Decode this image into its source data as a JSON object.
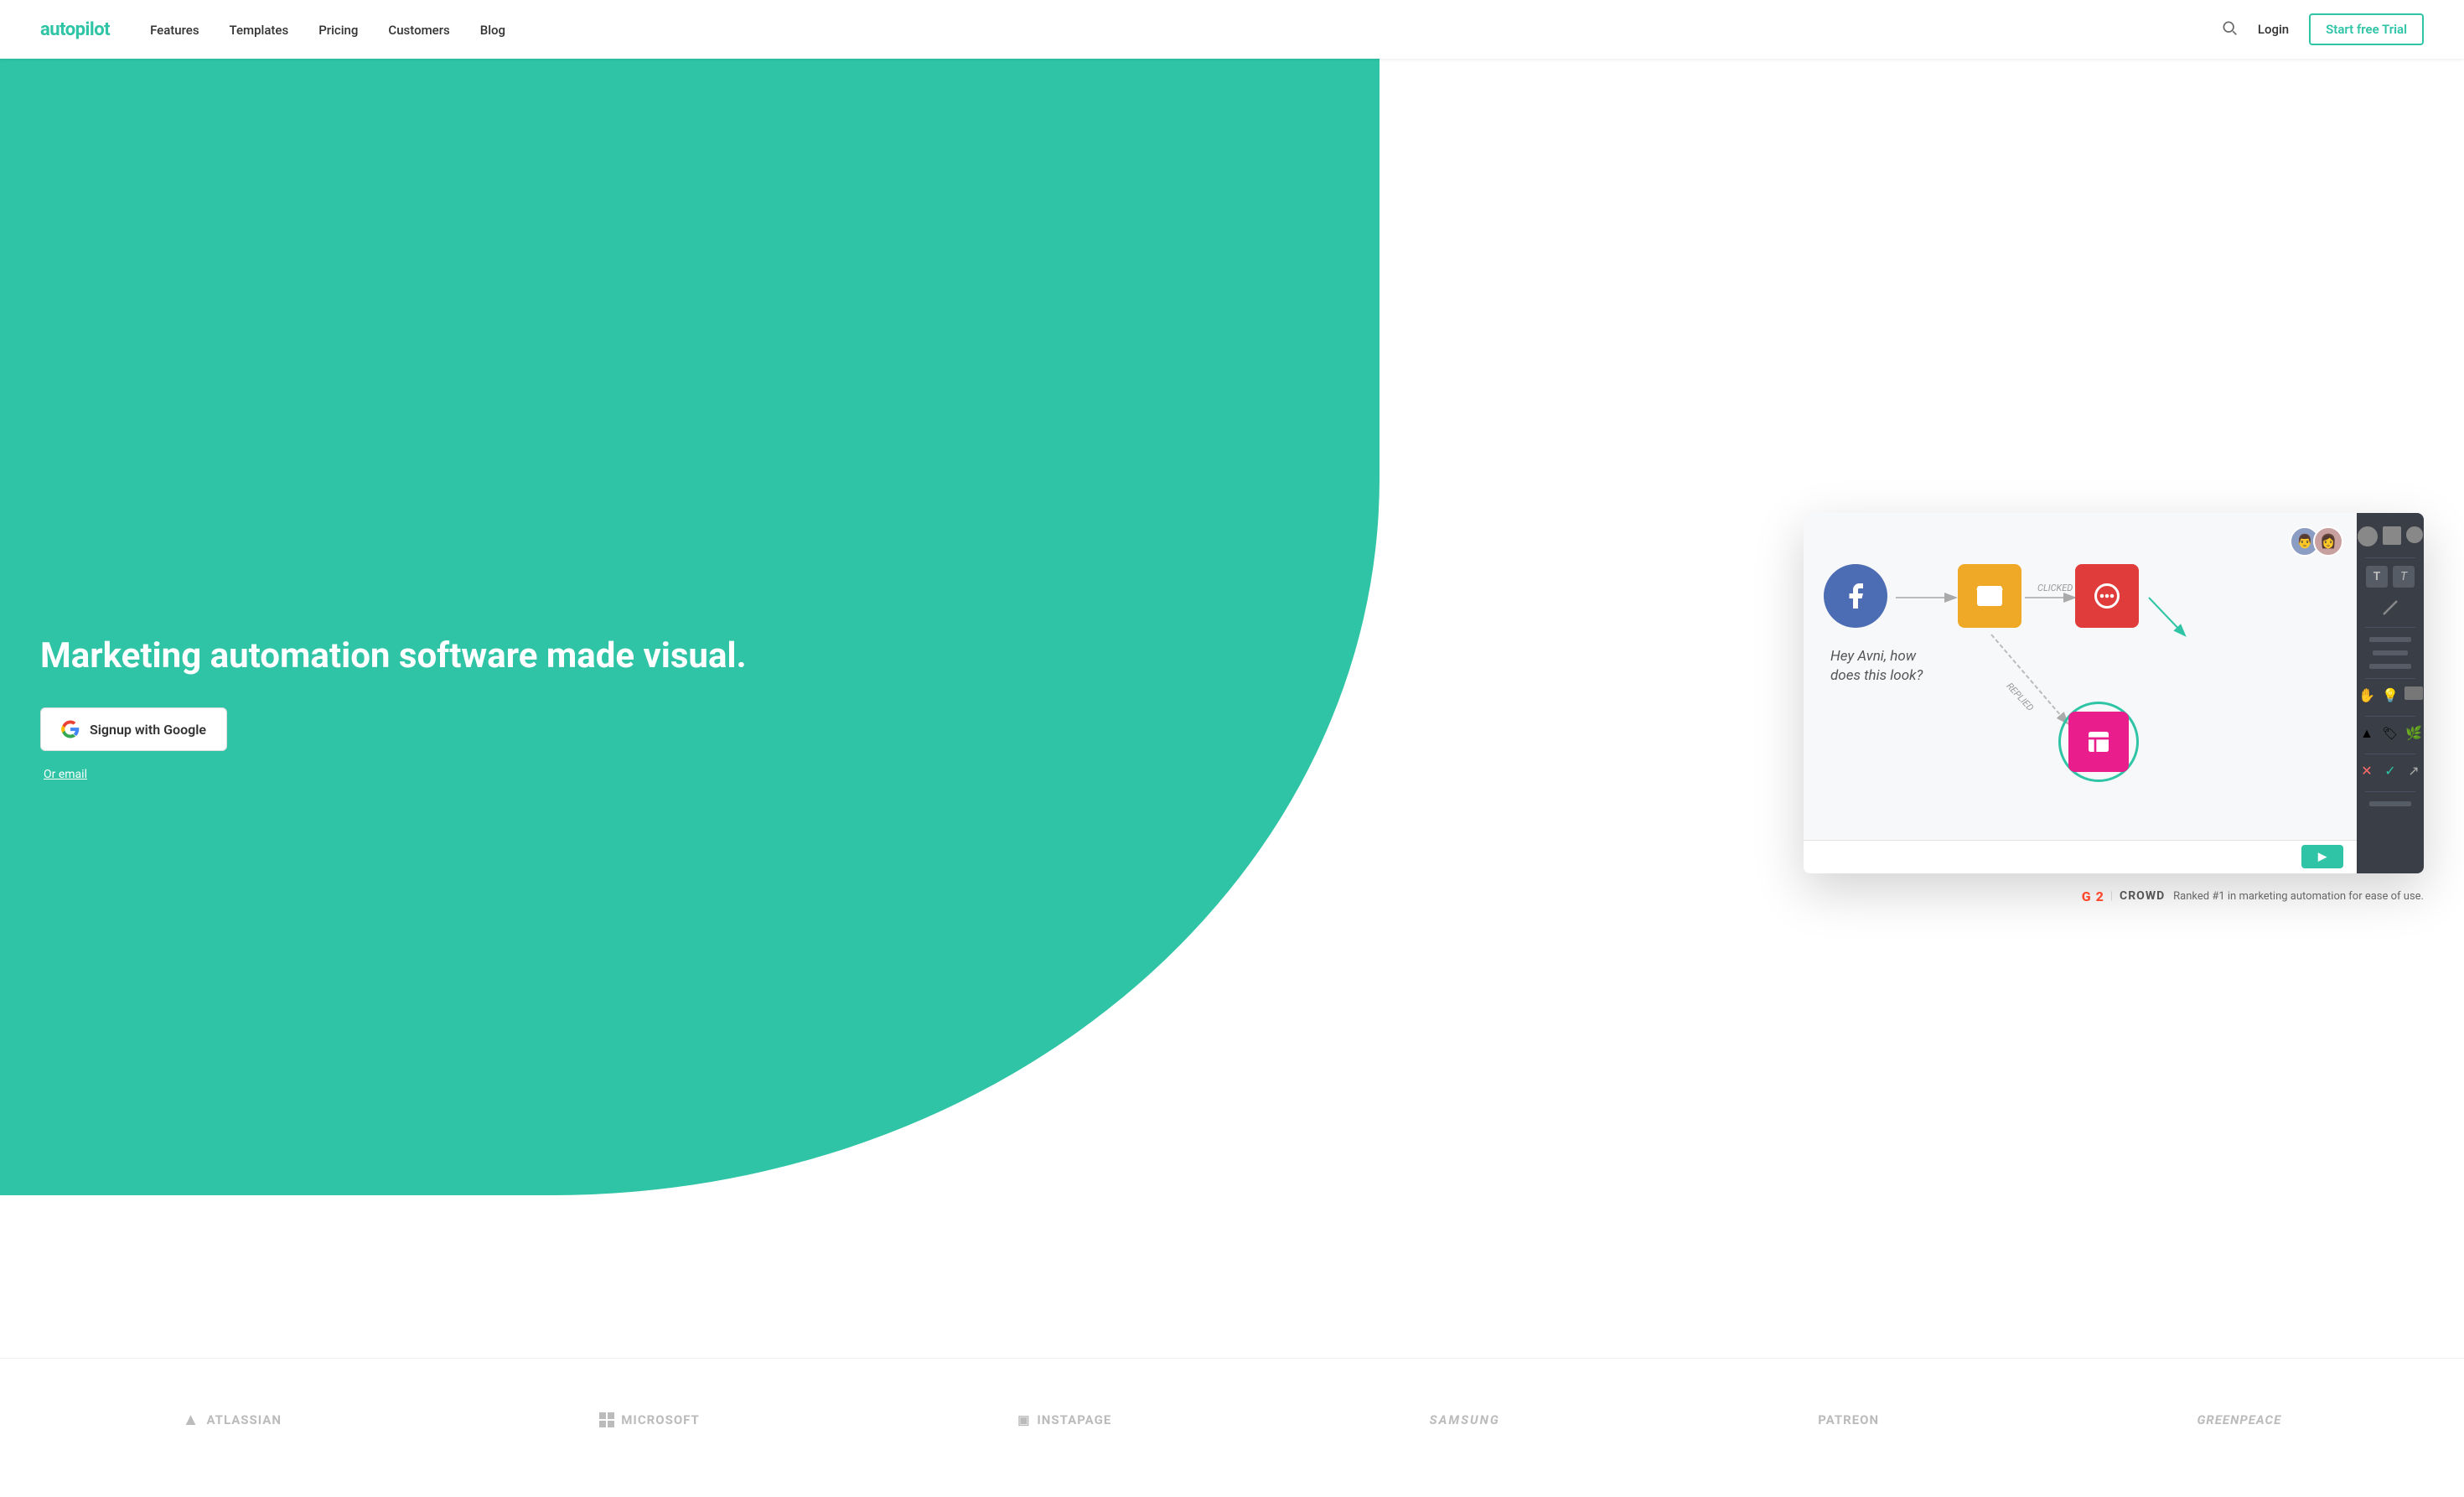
{
  "nav": {
    "logo": "autopilot",
    "links": [
      {
        "label": "Features",
        "href": "#"
      },
      {
        "label": "Templates",
        "href": "#"
      },
      {
        "label": "Pricing",
        "href": "#"
      },
      {
        "label": "Customers",
        "href": "#"
      },
      {
        "label": "Blog",
        "href": "#"
      }
    ],
    "login_label": "Login",
    "trial_label": "Start free Trial"
  },
  "hero": {
    "headline": "Marketing automation software made visual.",
    "google_btn": "Signup with Google",
    "or_email": "Or email"
  },
  "flow": {
    "clicked_label": "CLICKED",
    "replied_label": "REPLIED",
    "speech_text": "Hey Avni, how does this look?"
  },
  "g2": {
    "logo": "G2",
    "crowd": "CROWD",
    "pipe": "|",
    "ranked_text": "Ranked #1 in marketing automation for ease of use."
  },
  "brands": [
    {
      "name": "ATLASSIAN",
      "icon": "▲"
    },
    {
      "name": "Microsoft",
      "icon": "⊞"
    },
    {
      "name": "Instapage",
      "icon": "▣"
    },
    {
      "name": "SAMSUNG",
      "icon": ""
    },
    {
      "name": "PATREON",
      "icon": ""
    },
    {
      "name": "GREENPEACE",
      "icon": ""
    }
  ],
  "toolbar": {
    "items": [
      "circle",
      "square",
      "small-circle",
      "T",
      "italic-T",
      "line",
      "text-line",
      "text-line2",
      "line2",
      "hand",
      "bulb",
      "rect",
      "sep",
      "triangle",
      "tag",
      "person",
      "cross",
      "check",
      "arrow",
      "sep2"
    ]
  }
}
